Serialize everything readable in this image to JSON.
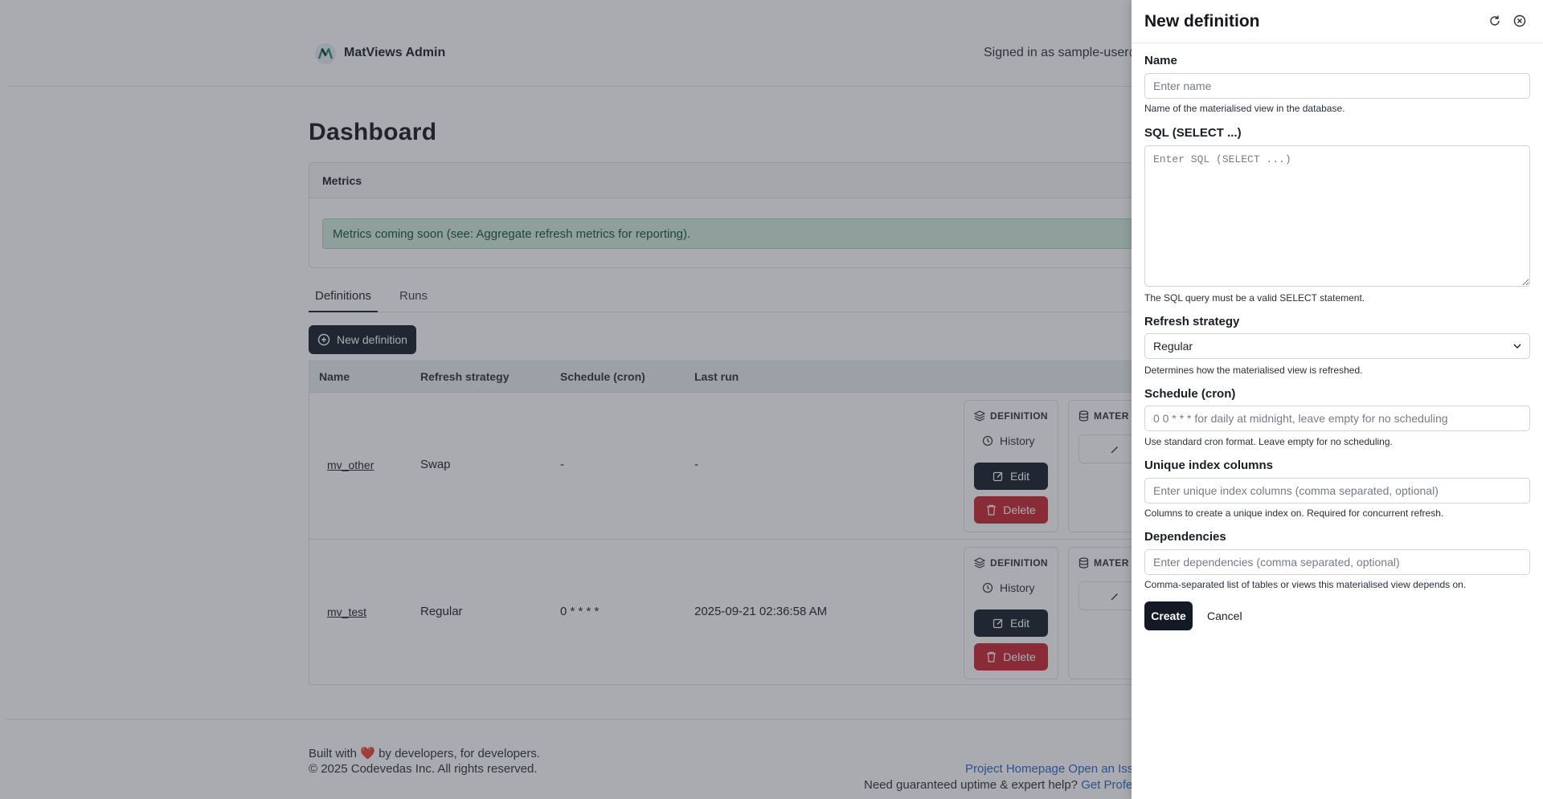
{
  "header": {
    "brand": "MatViews Admin",
    "signed_in": "Signed in as sample-user@e"
  },
  "page": {
    "title": "Dashboard",
    "metrics_title": "Metrics",
    "metrics_alert": "Metrics coming soon (see: Aggregate refresh metrics for reporting)."
  },
  "tabs": [
    {
      "label": "Definitions",
      "active": true
    },
    {
      "label": "Runs",
      "active": false
    }
  ],
  "new_definition_button": "New definition",
  "table": {
    "columns": [
      "Name",
      "Refresh strategy",
      "Schedule (cron)",
      "Last run"
    ],
    "rows": [
      {
        "name": "mv_other",
        "strategy": "Swap",
        "schedule": "-",
        "last_run": "-"
      },
      {
        "name": "mv_test",
        "strategy": "Regular",
        "schedule": "0 * * * *",
        "last_run": "2025-09-21 02:36:58 AM"
      }
    ],
    "actions": {
      "definition_title": "DEFINITION",
      "materialized_title": "MATER",
      "history": "History",
      "edit": "Edit",
      "delete": "Delete"
    }
  },
  "footer": {
    "built_with_prefix": "Built with",
    "heart": "❤️",
    "built_with_suffix": "by developers, for developers.",
    "copyright": "© 2025 Codevedas Inc. All rights reserved.",
    "links": "Project Homepage Open an Iss",
    "help_text": "Need guaranteed uptime & expert help?",
    "help_link": "Get Profe"
  },
  "drawer": {
    "title": "New definition",
    "fields": {
      "name": {
        "label": "Name",
        "placeholder": "Enter name",
        "help": "Name of the materialised view in the database."
      },
      "sql": {
        "label": "SQL (SELECT ...)",
        "placeholder": "Enter SQL (SELECT ...)",
        "help": "The SQL query must be a valid SELECT statement."
      },
      "refresh": {
        "label": "Refresh strategy",
        "value": "Regular",
        "help": "Determines how the materialised view is refreshed."
      },
      "schedule": {
        "label": "Schedule (cron)",
        "placeholder": "0 0 * * * for daily at midnight, leave empty for no scheduling",
        "help": "Use standard cron format. Leave empty for no scheduling."
      },
      "unique": {
        "label": "Unique index columns",
        "placeholder": "Enter unique index columns (comma separated, optional)",
        "help": "Columns to create a unique index on. Required for concurrent refresh."
      },
      "deps": {
        "label": "Dependencies",
        "placeholder": "Enter dependencies (comma separated, optional)",
        "help": "Comma-separated list of tables or views this materialised view depends on."
      }
    },
    "create_button": "Create",
    "cancel_button": "Cancel"
  },
  "colors": {
    "primary": "#131a26",
    "danger": "#c9252f",
    "success_bg": "#d1eadc",
    "link": "#2d62c8"
  }
}
